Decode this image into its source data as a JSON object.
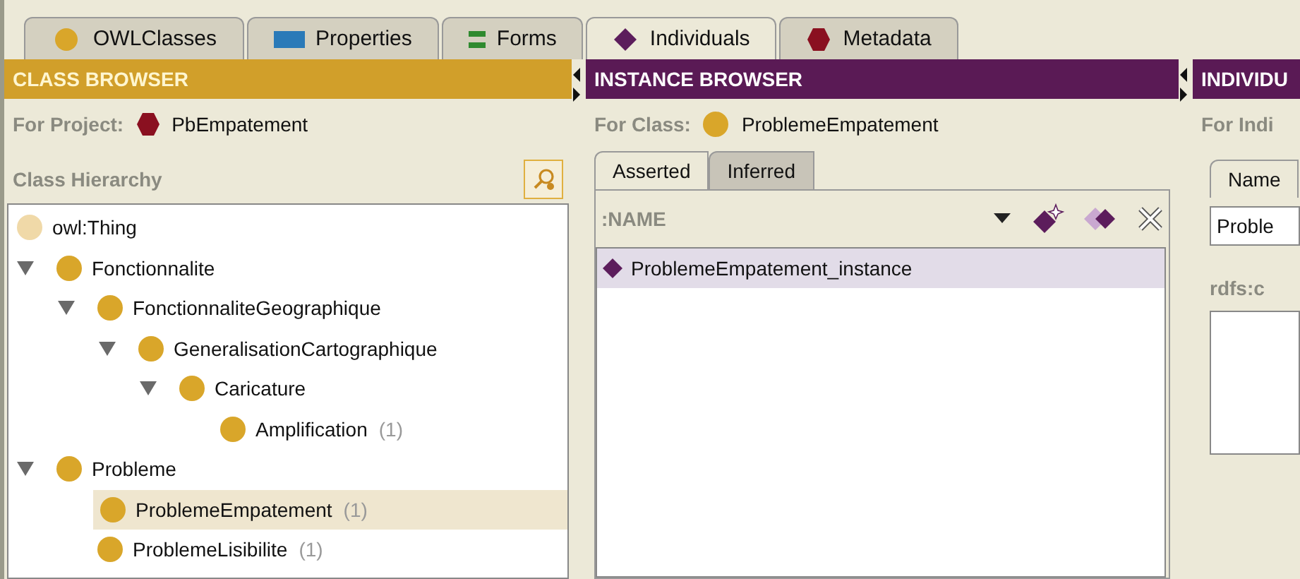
{
  "tabs": [
    {
      "label": "OWLClasses",
      "kind": "class",
      "selected": false
    },
    {
      "label": "Properties",
      "kind": "property",
      "selected": false
    },
    {
      "label": "Forms",
      "kind": "form",
      "selected": false
    },
    {
      "label": "Individuals",
      "kind": "individual",
      "selected": true
    },
    {
      "label": "Metadata",
      "kind": "metadata",
      "selected": false
    }
  ],
  "class_browser": {
    "title": "CLASS BROWSER",
    "project_label": "For Project:",
    "project": "PbEmpatement",
    "hierarchy_label": "Class Hierarchy",
    "tree": [
      {
        "label": "owl:Thing",
        "kind": "thing",
        "selected": false
      },
      {
        "label": "Fonctionnalite",
        "kind": "class",
        "expanded": true,
        "selected": false,
        "children": [
          {
            "label": "FonctionnaliteGeographique",
            "kind": "class",
            "expanded": true,
            "selected": false,
            "children": [
              {
                "label": "GeneralisationCartographique",
                "kind": "class",
                "expanded": true,
                "selected": false,
                "children": [
                  {
                    "label": "Caricature",
                    "kind": "class",
                    "expanded": true,
                    "selected": false,
                    "children": [
                      {
                        "label": "Amplification",
                        "count": "(1)",
                        "kind": "class",
                        "selected": false
                      }
                    ]
                  }
                ]
              }
            ]
          }
        ]
      },
      {
        "label": "Probleme",
        "kind": "class",
        "expanded": true,
        "selected": false,
        "children": [
          {
            "label": "ProblemeEmpatement",
            "count": "(1)",
            "kind": "class",
            "selected": true
          },
          {
            "label": "ProblemeLisibilite",
            "count": "(1)",
            "kind": "class",
            "selected": false
          }
        ]
      }
    ]
  },
  "instance_browser": {
    "title": "INSTANCE BROWSER",
    "class_label": "For Class:",
    "class_name": "ProblemeEmpatement",
    "tabs": [
      {
        "label": "Asserted",
        "selected": true
      },
      {
        "label": "Inferred",
        "selected": false
      }
    ],
    "column": ":NAME",
    "instances": [
      {
        "label": "ProblemeEmpatement_instance",
        "selected": true
      }
    ]
  },
  "individual_editor": {
    "title": "INDIVIDU",
    "for_label": "For Indi",
    "tab": "Name",
    "name_value": "Proble",
    "property_label": "rdfs:c"
  }
}
